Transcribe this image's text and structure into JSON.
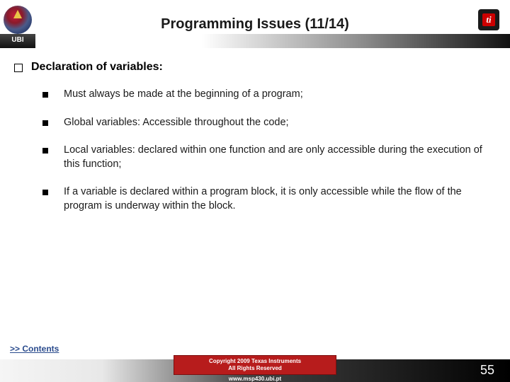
{
  "header": {
    "ubi_label": "UBI",
    "title": "Programming Issues (11/14)"
  },
  "content": {
    "heading": "Declaration of variables:",
    "bullets": [
      "Must always be made at the beginning of a program;",
      "Global variables: Accessible throughout the code;",
      "Local variables: declared within one function and are only accessible during the execution of this function;",
      "If a variable is declared within a program block, it is only accessible while the flow of the program is underway within the block."
    ]
  },
  "footer": {
    "contents_link": ">> Contents",
    "copyright_line1": "Copyright 2009 Texas Instruments",
    "copyright_line2": "All Rights Reserved",
    "url": "www.msp430.ubi.pt",
    "page_number": "55"
  }
}
